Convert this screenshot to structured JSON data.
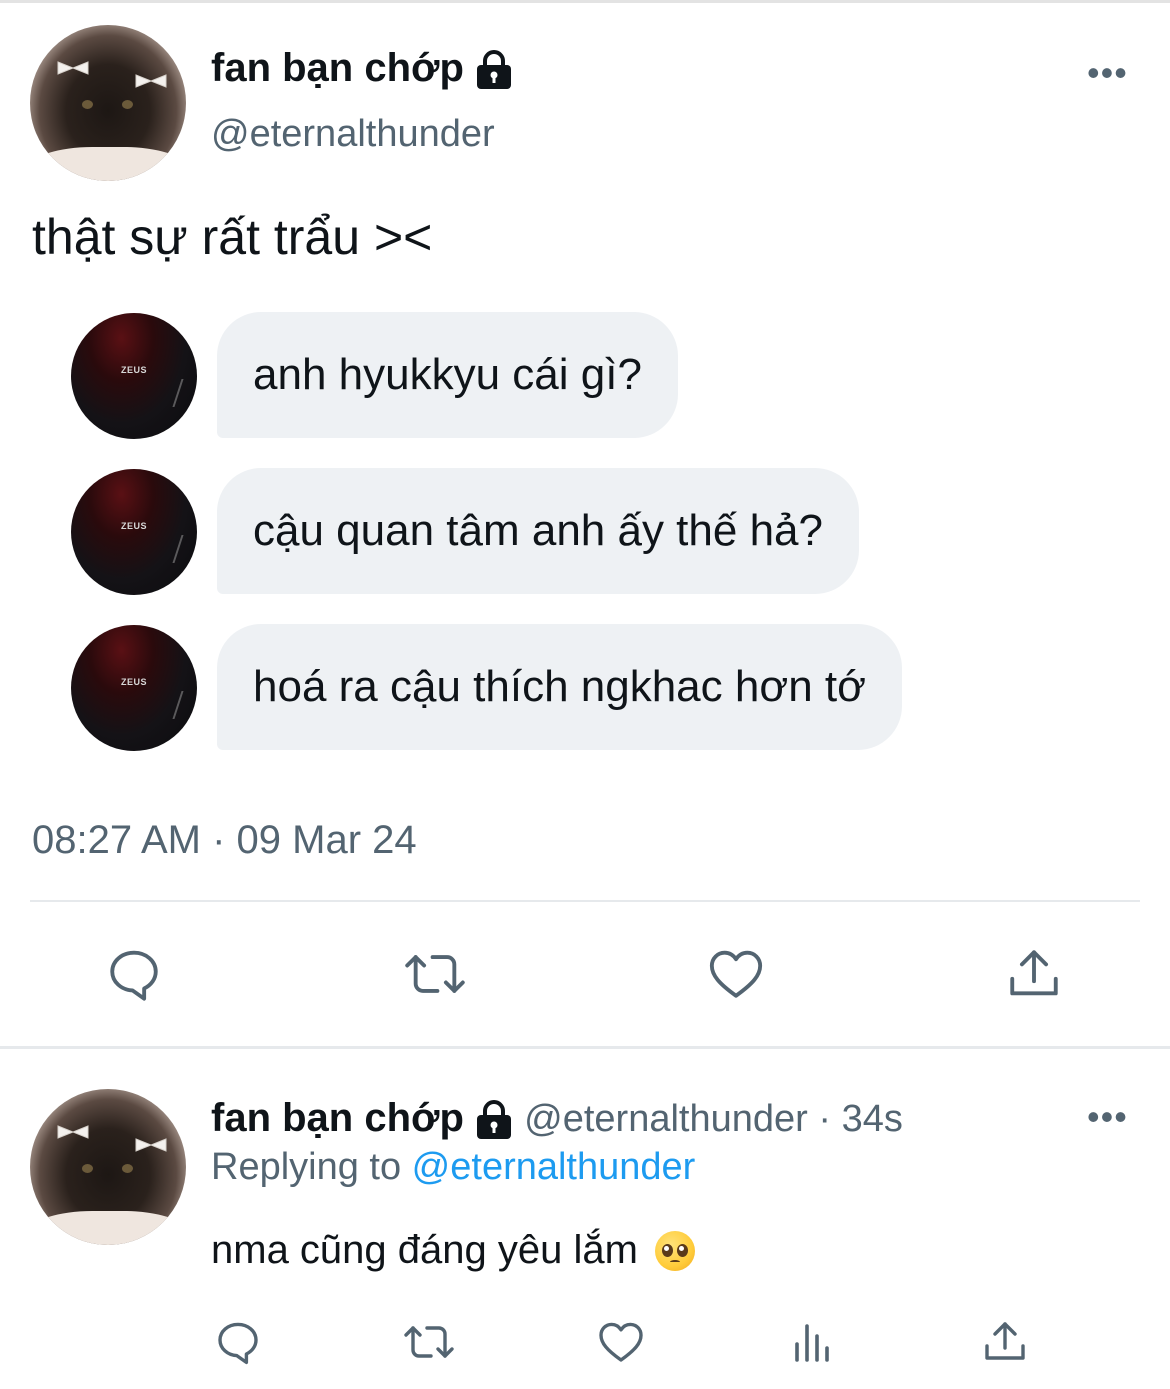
{
  "main_tweet": {
    "display_name": "fan bạn chớp",
    "handle": "@eternalthunder",
    "more_label": "•••",
    "text": "thật sự rất trẩu ><",
    "messages": [
      {
        "text": "anh hyukkyu cái gì?"
      },
      {
        "text": "cậu quan tâm anh ấy thế hả?"
      },
      {
        "text": "hoá ra cậu thích ngkhac hơn tớ"
      }
    ],
    "avatar_label": "ZEUS",
    "timestamp": "08:27 AM · 09 Mar 24",
    "actions": [
      "reply-icon",
      "retweet-icon",
      "like-icon",
      "share-icon"
    ]
  },
  "reply_tweet": {
    "display_name": "fan bạn chớp",
    "handle": "@eternalthunder",
    "time": " · 34s",
    "more_label": "•••",
    "replying_prefix": "Replying to ",
    "replying_mention": "@eternalthunder",
    "text": "nma cũng đáng yêu lắm",
    "emoji": "pleading-face",
    "actions": [
      "reply-icon",
      "retweet-icon",
      "like-icon",
      "views-icon",
      "share-icon"
    ]
  },
  "colors": {
    "text": "#0f1419",
    "secondary": "#536471",
    "link": "#1d9bf0",
    "bubble": "#eef1f4",
    "divider": "#e6e9ec"
  }
}
